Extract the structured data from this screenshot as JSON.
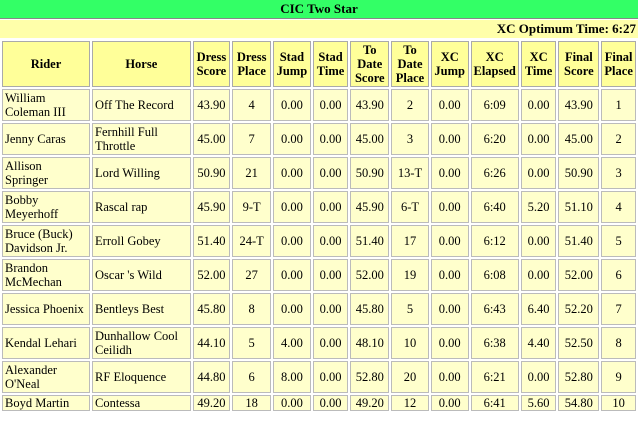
{
  "title": "CIC Two Star",
  "xc_optimum_time": "XC Optimum Time: 6:27",
  "columns": [
    "Rider",
    "Horse",
    "Dress Score",
    "Dress Place",
    "Stad Jump",
    "Stad Time",
    "To Date Score",
    "To Date Place",
    "XC Jump",
    "XC Elapsed",
    "XC Time",
    "Final Score",
    "Final Place"
  ],
  "rows": [
    [
      "William Coleman III",
      "Off The Record",
      "43.90",
      "4",
      "0.00",
      "0.00",
      "43.90",
      "2",
      "0.00",
      "6:09",
      "0.00",
      "43.90",
      "1"
    ],
    [
      "Jenny Caras",
      "Fernhill Full Throttle",
      "45.00",
      "7",
      "0.00",
      "0.00",
      "45.00",
      "3",
      "0.00",
      "6:20",
      "0.00",
      "45.00",
      "2"
    ],
    [
      "Allison Springer",
      "Lord Willing",
      "50.90",
      "21",
      "0.00",
      "0.00",
      "50.90",
      "13-T",
      "0.00",
      "6:26",
      "0.00",
      "50.90",
      "3"
    ],
    [
      "Bobby Meyerhoff",
      "Rascal rap",
      "45.90",
      "9-T",
      "0.00",
      "0.00",
      "45.90",
      "6-T",
      "0.00",
      "6:40",
      "5.20",
      "51.10",
      "4"
    ],
    [
      "Bruce (Buck) Davidson Jr.",
      "Erroll Gobey",
      "51.40",
      "24-T",
      "0.00",
      "0.00",
      "51.40",
      "17",
      "0.00",
      "6:12",
      "0.00",
      "51.40",
      "5"
    ],
    [
      "Brandon McMechan",
      "Oscar 's Wild",
      "52.00",
      "27",
      "0.00",
      "0.00",
      "52.00",
      "19",
      "0.00",
      "6:08",
      "0.00",
      "52.00",
      "6"
    ],
    [
      "Jessica Phoenix",
      "Bentleys Best",
      "45.80",
      "8",
      "0.00",
      "0.00",
      "45.80",
      "5",
      "0.00",
      "6:43",
      "6.40",
      "52.20",
      "7"
    ],
    [
      "Kendal Lehari",
      "Dunhallow Cool Ceilidh",
      "44.10",
      "5",
      "4.00",
      "0.00",
      "48.10",
      "10",
      "0.00",
      "6:38",
      "4.40",
      "52.50",
      "8"
    ],
    [
      "Alexander O'Neal",
      "RF Eloquence",
      "44.80",
      "6",
      "8.00",
      "0.00",
      "52.80",
      "20",
      "0.00",
      "6:21",
      "0.00",
      "52.80",
      "9"
    ],
    [
      "Boyd Martin",
      "Contessa",
      "49.20",
      "18",
      "0.00",
      "0.00",
      "49.20",
      "12",
      "0.00",
      "6:41",
      "5.60",
      "54.80",
      "10"
    ]
  ]
}
